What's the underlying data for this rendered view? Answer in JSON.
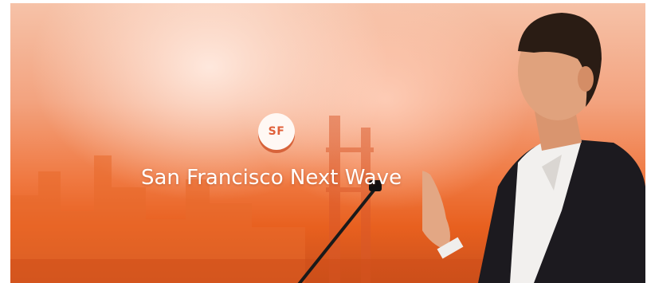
{
  "hero": {
    "badge_text": "SF",
    "title": "San Francisco Next Wave"
  },
  "colors": {
    "accent": "#e0603a",
    "title_text": "#ffffff"
  },
  "icons": {
    "badge": "sf-logo-icon"
  }
}
